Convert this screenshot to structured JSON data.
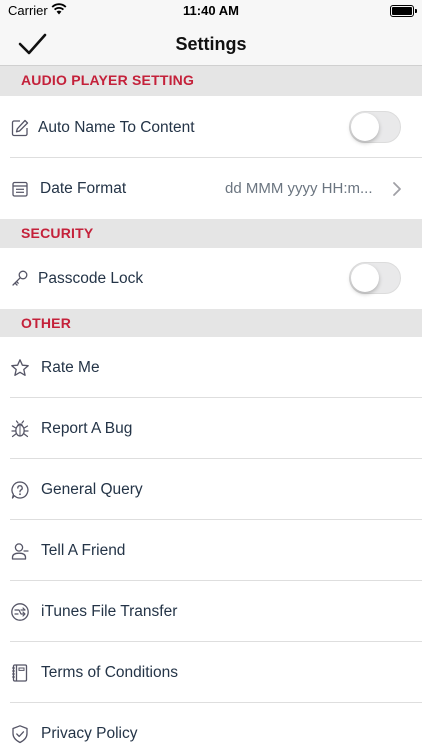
{
  "status_bar": {
    "carrier": "Carrier",
    "time": "11:40 AM",
    "wifi_icon": "wifi-icon",
    "battery_icon": "battery-icon"
  },
  "nav": {
    "title": "Settings",
    "done_icon": "checkmark-icon"
  },
  "colors": {
    "section_header_text": "#c4213a",
    "section_header_bg": "#e5e5e5",
    "row_text": "#243447"
  },
  "sections": [
    {
      "header": "AUDIO PLAYER SETTING",
      "rows": [
        {
          "label": "Auto Name To Content",
          "icon": "edit-icon",
          "control": "toggle",
          "toggle_on": false
        },
        {
          "label": "Date Format",
          "icon": "calendar-list-icon",
          "value": "dd MMM yyyy HH:m...",
          "control": "disclosure"
        }
      ]
    },
    {
      "header": "SECURITY",
      "rows": [
        {
          "label": "Passcode Lock",
          "icon": "key-icon",
          "control": "toggle",
          "toggle_on": false
        }
      ]
    },
    {
      "header": "OTHER",
      "rows": [
        {
          "label": "Rate Me",
          "icon": "star-icon"
        },
        {
          "label": "Report A Bug",
          "icon": "bug-icon"
        },
        {
          "label": "General Query",
          "icon": "question-icon"
        },
        {
          "label": "Tell A Friend",
          "icon": "person-icon"
        },
        {
          "label": "iTunes File Transfer",
          "icon": "transfer-icon"
        },
        {
          "label": "Terms of Conditions",
          "icon": "notebook-icon"
        },
        {
          "label": "Privacy Policy",
          "icon": "shield-check-icon"
        }
      ]
    }
  ]
}
